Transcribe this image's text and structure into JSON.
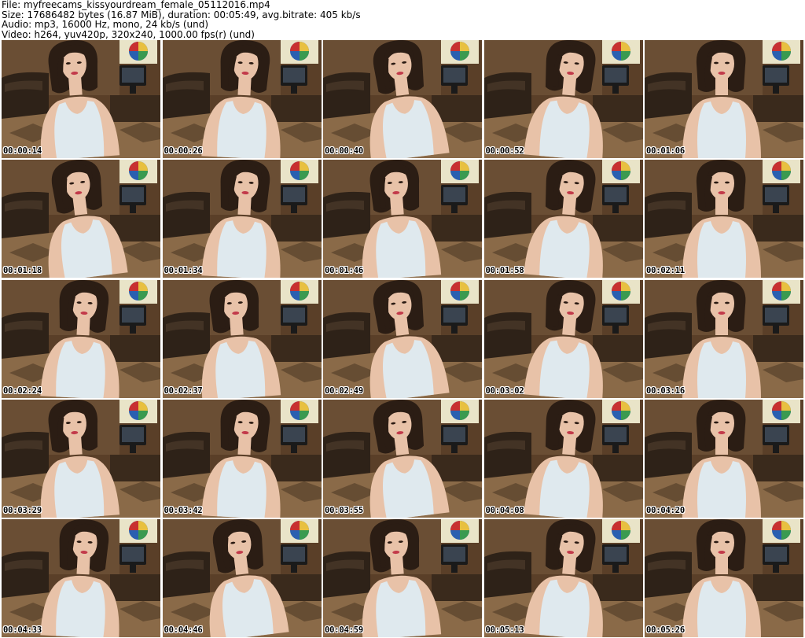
{
  "header": {
    "file_line": "File: myfreecams_kissyourdream_female_05112016.mp4",
    "size_line": "Size: 17686482 bytes (16.87 MiB), duration: 00:05:49, avg.bitrate: 405 kb/s",
    "audio_line": "Audio: mp3, 16000 Hz, mono, 24 kb/s (und)",
    "video_line": "Video: h264, yuv420p, 320x240, 1000.00 fps(r) (und)"
  },
  "thumbnails": [
    {
      "time": "00:00:14",
      "variant": 0
    },
    {
      "time": "00:00:26",
      "variant": 1
    },
    {
      "time": "00:00:40",
      "variant": 2
    },
    {
      "time": "00:00:52",
      "variant": 3
    },
    {
      "time": "00:01:06",
      "variant": 4
    },
    {
      "time": "00:01:18",
      "variant": 2
    },
    {
      "time": "00:01:34",
      "variant": 1
    },
    {
      "time": "00:01:46",
      "variant": 0
    },
    {
      "time": "00:01:58",
      "variant": 3
    },
    {
      "time": "00:02:11",
      "variant": 4
    },
    {
      "time": "00:02:24",
      "variant": 1
    },
    {
      "time": "00:02:37",
      "variant": 0
    },
    {
      "time": "00:02:49",
      "variant": 2
    },
    {
      "time": "00:03:02",
      "variant": 3
    },
    {
      "time": "00:03:16",
      "variant": 4
    },
    {
      "time": "00:03:29",
      "variant": 0
    },
    {
      "time": "00:03:42",
      "variant": 1
    },
    {
      "time": "00:03:55",
      "variant": 2
    },
    {
      "time": "00:04:08",
      "variant": 3
    },
    {
      "time": "00:04:20",
      "variant": 4
    },
    {
      "time": "00:04:33",
      "variant": 1
    },
    {
      "time": "00:04:46",
      "variant": 2
    },
    {
      "time": "00:04:59",
      "variant": 0
    },
    {
      "time": "00:05:13",
      "variant": 3
    },
    {
      "time": "00:05:26",
      "variant": 4
    }
  ],
  "colors": {
    "wall": "#5a3f28",
    "sofa": "#2e2218",
    "rug": "#8a6a48",
    "skin": "#e8c2a8",
    "hair": "#2b1d14",
    "top": "#dfe9ee",
    "lips": "#c23a4a",
    "poster_bg": "#e9e4c8",
    "poster_blue": "#2a5fb0",
    "poster_red": "#c83030",
    "poster_yellow": "#e8c040",
    "poster_green": "#3a9a50",
    "monitor": "#1a1a1a"
  }
}
